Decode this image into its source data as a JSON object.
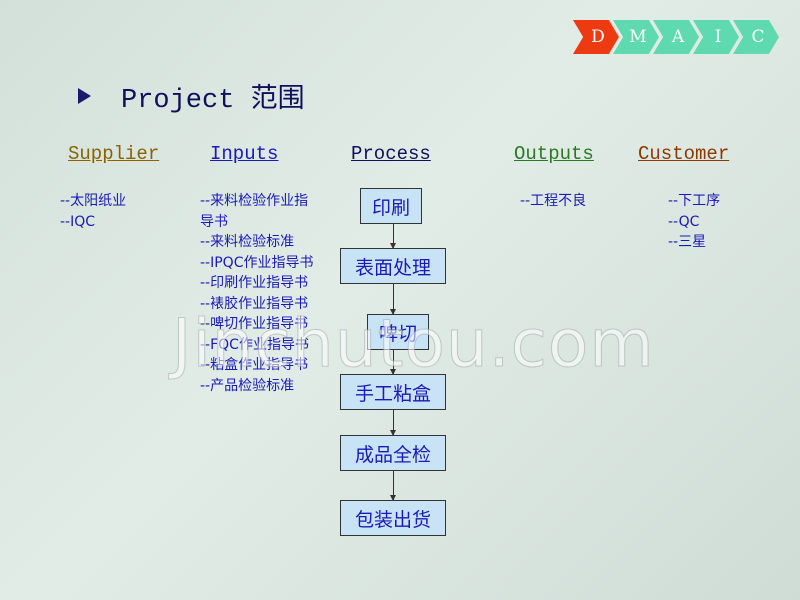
{
  "dmaic": {
    "steps": [
      "D",
      "M",
      "A",
      "I",
      "C"
    ],
    "active": "D",
    "active_color": "#ee3a10",
    "inactive_color": "#5ed9b0"
  },
  "title": "Project 范围",
  "headers": {
    "supplier": "Supplier",
    "inputs": "Inputs",
    "process": "Process",
    "outputs": "Outputs",
    "customer": "Customer"
  },
  "header_colors": {
    "supplier": "#8a6200",
    "inputs": "#1a1ab4",
    "process": "#10105a",
    "outputs": "#2a7a20",
    "customer": "#8a3a00"
  },
  "supplier": [
    "--太阳纸业",
    "--IQC"
  ],
  "inputs": [
    "--来料检验作业指导书",
    "--来料检验标准",
    "--IPQC作业指导书",
    "--印刷作业指导书",
    "--裱胶作业指导书",
    "--啤切作业指导书",
    "--FQC作业指导书",
    "--粘盒作业指导书",
    "--产品检验标准"
  ],
  "process": [
    "印刷",
    "表面处理",
    "啤切",
    "手工粘盒",
    "成品全检",
    "包装出货"
  ],
  "outputs": [
    "--工程不良"
  ],
  "customer": [
    "--下工序",
    "--QC",
    "--三星"
  ],
  "watermark": "Jinchutou.com"
}
